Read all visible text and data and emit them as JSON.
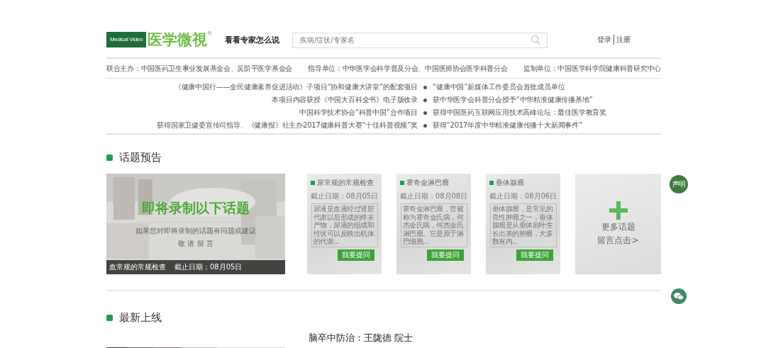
{
  "header": {
    "logo": {
      "tag": "Medical Video",
      "name": "医学微視",
      "mark": "®"
    },
    "slogan": "看看专家怎么说",
    "search": {
      "placeholder": "疾病/症状/专家名"
    },
    "auth_links": [
      "登录",
      "注册"
    ]
  },
  "sponsors": [
    "联合主办：中国医药卫生事业发展基金会、吴阶平医学基金会",
    "指导单位：中华医学会科学普及分会、中国医师协会医学科普分会",
    "监制单位：中国医学科学院健康科普研究中心"
  ],
  "honors": [
    {
      "left": "《健康中国行——全民健康素养促进活动》子项目“协和健康大讲堂”的配套项目",
      "right": "“健康中国”新媒体工作委员会首批成员单位"
    },
    {
      "left": "本项目内容获授《中国大百科全书》电子版收录",
      "right": "获中华医学会科普分会授予“中华精准健康传播基地”"
    },
    {
      "left": "中国科学技术协会“科普中国”合作项目",
      "right": "获得中国医药互联网应用技术高峰论坛：最佳医学教育奖"
    },
    {
      "left": "获得国家卫健委宣传司指导、《健康报》社主办2017健康科普大赛“十佳科普视频”奖",
      "right": "获得“2017年度中华精准健康传播十大新闻事件”"
    }
  ],
  "topics": {
    "title": "话题预告",
    "featured": {
      "heading": "即将录制以下话题",
      "subtitle": "如果您对即将录制的话题有问题或建议",
      "invite": "敬 请 留 言",
      "caption_title": "血常规的常规检查",
      "caption_date": "截止日期：08月05日"
    },
    "cards": [
      {
        "title": "尿常规的常规检查",
        "deadline": "截止日期：08月05日",
        "description": "尿液是血液经过肾脏代谢以后形成的终末产物，尿液的组成和性状可以反映出机体的代谢...",
        "button": "我要提问"
      },
      {
        "title": "霍奇金淋巴瘤",
        "deadline": "截止日期：08月08日",
        "description": "霍奇金淋巴瘤，曾被称为霍奇金氏病，何杰金氏病，何杰金氏淋巴瘤。它是原于淋巴细胞...",
        "button": "我要提问"
      },
      {
        "title": "垂体腺瘤",
        "deadline": "截止日期：08月06日",
        "description": "垂体腺瘤，是常见的良性肿瘤之一，垂体腺瘤是从垂体前叶生长出来的肿瘤，大多数有内...",
        "button": "我要提问"
      }
    ],
    "more": {
      "line1": "更多话题",
      "line2": "留言点击>"
    }
  },
  "latest": {
    "title": "最新上线",
    "items": [
      {
        "kind": "picture",
        "title": "脑卒中防治：王陇德 院士"
      }
    ]
  },
  "side": {
    "statement": "声明"
  }
}
